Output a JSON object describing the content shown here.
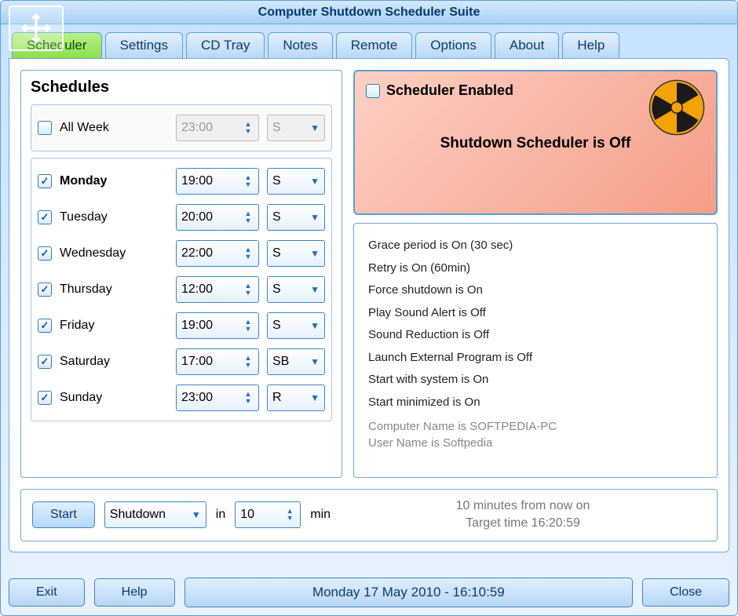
{
  "window": {
    "title": "Computer Shutdown Scheduler Suite"
  },
  "tabs": [
    "Scheduler",
    "Settings",
    "CD Tray",
    "Notes",
    "Remote",
    "Options",
    "About",
    "Help"
  ],
  "active_tab": 0,
  "schedules": {
    "heading": "Schedules",
    "all_week": {
      "label": "All Week",
      "checked": false,
      "time": "23:00",
      "action": "S"
    },
    "days": [
      {
        "label": "Monday",
        "checked": true,
        "time": "19:00",
        "action": "S",
        "bold": true
      },
      {
        "label": "Tuesday",
        "checked": true,
        "time": "20:00",
        "action": "S"
      },
      {
        "label": "Wednesday",
        "checked": true,
        "time": "22:00",
        "action": "S"
      },
      {
        "label": "Thursday",
        "checked": true,
        "time": "12:00",
        "action": "S"
      },
      {
        "label": "Friday",
        "checked": true,
        "time": "19:00",
        "action": "S"
      },
      {
        "label": "Saturday",
        "checked": true,
        "time": "17:00",
        "action": "SB"
      },
      {
        "label": "Sunday",
        "checked": true,
        "time": "23:00",
        "action": "R"
      }
    ]
  },
  "status": {
    "title": "Scheduler Enabled",
    "message": "Shutdown Scheduler is Off"
  },
  "info": {
    "lines": [
      "Grace period is On (30 sec)",
      "Retry is On (60min)",
      "Force shutdown is On",
      "Play Sound Alert is Off",
      "Sound Reduction is Off",
      "Launch External Program is Off",
      "Start with system is On",
      "Start minimized is On"
    ],
    "computer_line": "Computer Name is SOFTPEDIA-PC",
    "user_line": "User Name is Softpedia"
  },
  "quick": {
    "start_label": "Start",
    "action": "Shutdown",
    "in_label": "in",
    "minutes": "10",
    "min_label": "min",
    "countdown_line1": "10 minutes from now on",
    "countdown_line2": "Target time 16:20:59"
  },
  "bottom": {
    "exit": "Exit",
    "help": "Help",
    "datetime": "Monday 17 May 2010 - 16:10:59",
    "close": "Close"
  }
}
